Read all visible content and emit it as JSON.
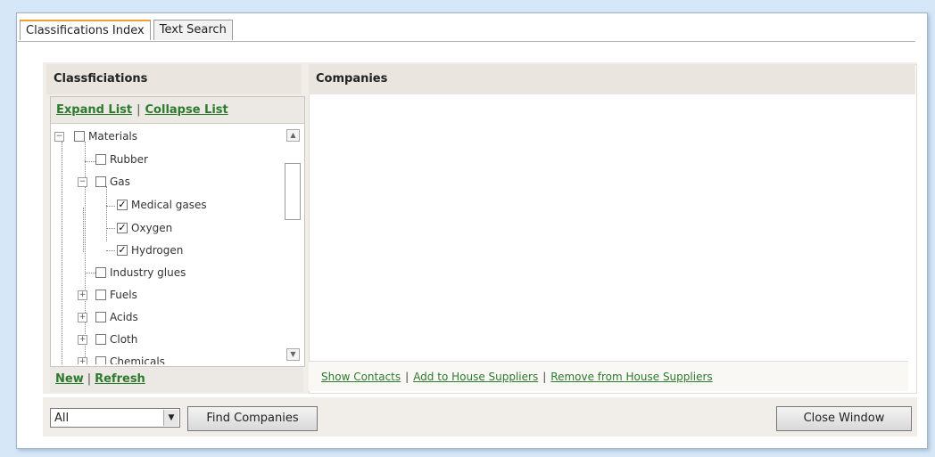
{
  "tabs": [
    {
      "label": "Classifications Index",
      "active": true
    },
    {
      "label": "Text Search",
      "active": false
    }
  ],
  "left_panel": {
    "title": "Classficiations",
    "expand_label": "Expand List",
    "collapse_label": "Collapse List",
    "footer_new": "New",
    "footer_refresh": "Refresh"
  },
  "tree": [
    {
      "label": "Materials",
      "checked": false,
      "expanded": true
    },
    {
      "label": "Rubber",
      "checked": false
    },
    {
      "label": "Gas",
      "checked": false,
      "expanded": true
    },
    {
      "label": "Medical gases",
      "checked": true
    },
    {
      "label": "Oxygen",
      "checked": true
    },
    {
      "label": "Hydrogen",
      "checked": true
    },
    {
      "label": "Industry glues",
      "checked": false
    },
    {
      "label": "Fuels",
      "checked": false,
      "expanded": false
    },
    {
      "label": "Acids",
      "checked": false,
      "expanded": false
    },
    {
      "label": "Cloth",
      "checked": false,
      "expanded": false
    },
    {
      "label": "Chemicals",
      "checked": false,
      "expanded": false
    }
  ],
  "right_panel": {
    "title": "Companies",
    "show_contacts": "Show Contacts",
    "add_suppliers": "Add to House Suppliers",
    "remove_suppliers": "Remove from House Suppliers"
  },
  "bottom": {
    "select_value": "All",
    "find_label": "Find Companies",
    "close_label": "Close Window"
  },
  "colors": {
    "background": "#d6e7f7",
    "link": "#2c7a2c",
    "tab_accent": "#f0a030"
  }
}
